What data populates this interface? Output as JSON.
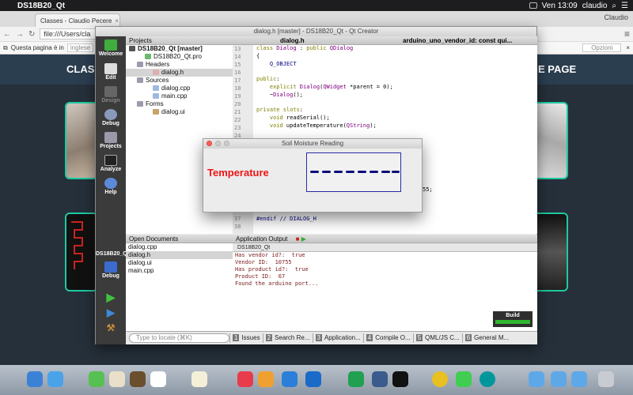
{
  "menubar": {
    "app_name": "DS18B20_Qt",
    "clock": "Ven 13:09",
    "user": "claudio"
  },
  "browser": {
    "tab_title": "Classes - Claudio Pecere",
    "user_name": "Claudio",
    "url": "file:///Users/cla",
    "translate_text": "Questa pagina è in",
    "translate_lang": "inglese",
    "options_label": "Opzioni",
    "nav_left": "CLAS",
    "nav_right": "E PAGE"
  },
  "qt": {
    "window_title": "dialog.h [master] - DS18B20_Qt - Qt Creator",
    "modes": [
      "Welcome",
      "Edit",
      "Design",
      "Debug",
      "Projects",
      "Analyze",
      "Help"
    ],
    "kit_label": "DS18B20_Qt",
    "kit_mode": "Debug",
    "projects_header": "Projects",
    "project_tree": [
      {
        "label": "DS18B20_Qt [master]",
        "level": 0
      },
      {
        "label": "DS18B20_Qt.pro",
        "level": 1
      },
      {
        "label": "Headers",
        "level": 1
      },
      {
        "label": "dialog.h",
        "level": 2
      },
      {
        "label": "Sources",
        "level": 1
      },
      {
        "label": "dialog.cpp",
        "level": 2
      },
      {
        "label": "main.cpp",
        "level": 2
      },
      {
        "label": "Forms",
        "level": 1
      },
      {
        "label": "dialog.ui",
        "level": 2
      }
    ],
    "editor_file": "dialog.h",
    "editor_symbol": "arduino_uno_vendor_id: const qui...",
    "code_line_numbers_top": [
      "13",
      "14",
      "15",
      "16",
      "17",
      "18",
      "19",
      "20",
      "21",
      "22",
      "23",
      "24",
      "25",
      "26"
    ],
    "code_line_numbers_bottom": [
      "37",
      "38"
    ],
    "code_fragments": [
      "55;",
      "#endif // DIALOG_H"
    ],
    "open_docs_header": "Open Documents",
    "open_docs": [
      "dialog.cpp",
      "dialog.h",
      "dialog.ui",
      "main.cpp"
    ],
    "output_header": "Application Output",
    "output_tab": "DS18B20_Qt",
    "output_lines": [
      "Has vendor id?:  true",
      "",
      "Vendor ID:  10755",
      "",
      "Has product id?:  true",
      "",
      "Product ID:  67",
      "",
      "Found the arduino port..."
    ],
    "build_label": "Build",
    "locate_placeholder": "Type to locate (⌘K)",
    "status_panes": [
      {
        "num": "1",
        "label": "Issues"
      },
      {
        "num": "2",
        "label": "Search Re..."
      },
      {
        "num": "3",
        "label": "Application..."
      },
      {
        "num": "4",
        "label": "Compile O..."
      },
      {
        "num": "5",
        "label": "QML/JS C..."
      },
      {
        "num": "6",
        "label": "General M..."
      }
    ]
  },
  "dialog": {
    "title": "Soil Moisture Reading",
    "label": "Temperature",
    "lcd_digits": "- - - - - - - -"
  }
}
